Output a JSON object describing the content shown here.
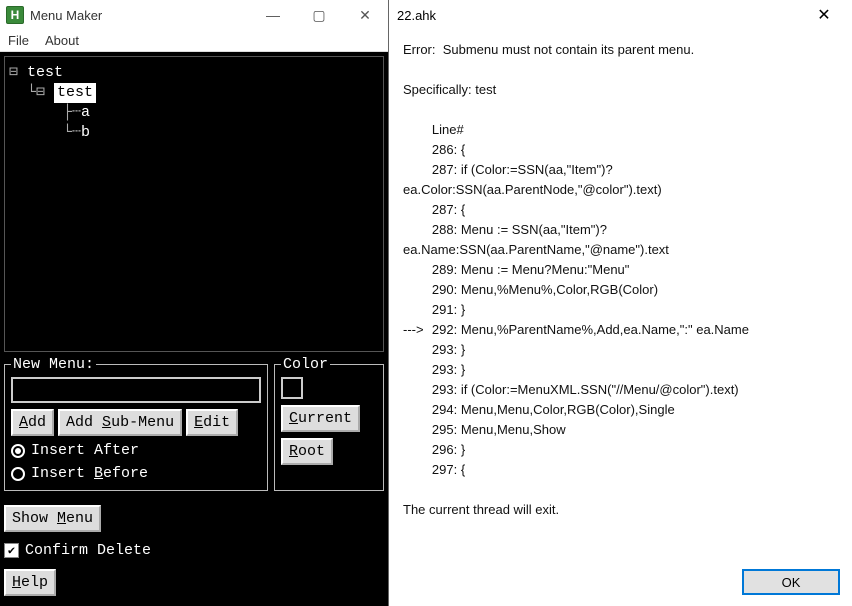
{
  "left": {
    "title": "Menu Maker",
    "app_icon_letter": "H",
    "menubar": {
      "file": "File",
      "about": "About"
    },
    "tree": {
      "root": "test",
      "selected": "test",
      "children": [
        "a",
        "b"
      ]
    },
    "new_menu": {
      "legend": "New Menu:",
      "input_value": "",
      "add": "Add",
      "add_sub": "Add Sub-Menu",
      "edit": "Edit",
      "insert_after": "Insert After",
      "insert_before": "Insert Before",
      "selected_radio": "after"
    },
    "color": {
      "legend": "Color",
      "current": "Current",
      "root": "Root",
      "swatch": "#000000"
    },
    "show_menu": "Show Menu",
    "confirm_delete": {
      "label": "Confirm Delete",
      "checked": true
    },
    "help": "Help"
  },
  "dialog": {
    "title": "22.ahk",
    "error_line": "Error:  Submenu must not contain its parent menu.",
    "specifically": "Specifically: test",
    "lines_header": "Line#",
    "lines": [
      {
        "ptr": "",
        "n": "286",
        "t": "{"
      },
      {
        "ptr": "",
        "n": "287",
        "t": "if (Color:=SSN(aa,\"Item\")?ea.Color:SSN(aa.ParentNode,\"@color\").text)"
      },
      {
        "ptr": "",
        "n": "287",
        "t": "{"
      },
      {
        "ptr": "",
        "n": "288",
        "t": "Menu := SSN(aa,\"Item\")?ea.Name:SSN(aa.ParentName,\"@name\").text"
      },
      {
        "ptr": "",
        "n": "289",
        "t": "Menu := Menu?Menu:\"Menu\""
      },
      {
        "ptr": "",
        "n": "290",
        "t": "Menu,%Menu%,Color,RGB(Color)"
      },
      {
        "ptr": "",
        "n": "291",
        "t": "}"
      },
      {
        "ptr": "--->",
        "n": "292",
        "t": "Menu,%ParentName%,Add,ea.Name,\":\" ea.Name"
      },
      {
        "ptr": "",
        "n": "293",
        "t": "}"
      },
      {
        "ptr": "",
        "n": "293",
        "t": "}"
      },
      {
        "ptr": "",
        "n": "293",
        "t": "if (Color:=MenuXML.SSN(\"//Menu/@color\").text)"
      },
      {
        "ptr": "",
        "n": "294",
        "t": "Menu,Menu,Color,RGB(Color),Single"
      },
      {
        "ptr": "",
        "n": "295",
        "t": "Menu,Menu,Show"
      },
      {
        "ptr": "",
        "n": "296",
        "t": "}"
      },
      {
        "ptr": "",
        "n": "297",
        "t": "{"
      }
    ],
    "footer_text": "The current thread will exit.",
    "ok": "OK"
  }
}
